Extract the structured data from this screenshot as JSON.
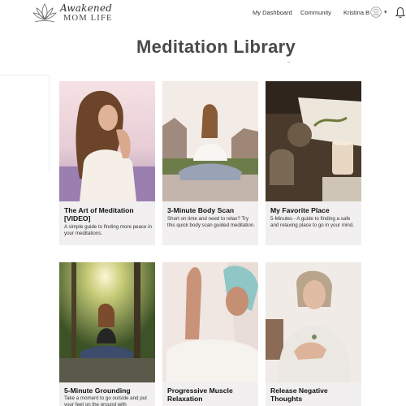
{
  "header": {
    "logo": {
      "line1": "Awakened",
      "line2": "MOM LIFE"
    },
    "nav": {
      "dashboard": "My Dashboard",
      "community": "Community",
      "user": "Kristina B"
    },
    "icons": {
      "avatar": "user-avatar-icon",
      "dropdown": "chevron-down-icon",
      "notifications": "bell-icon"
    }
  },
  "page": {
    "title": "Meditation Library"
  },
  "cards": [
    {
      "title": "The Art of Meditation [VIDEO]",
      "desc": "A simple guide to finding more peace in your meditations."
    },
    {
      "title": "3-Minute Body Scan",
      "desc": "Short on time and need to relax? Try this quick body scan guided meditation."
    },
    {
      "title": "My Favorite Place",
      "desc": "5-Minutes - A guide to finding a safe and relaxing place to go in your mind."
    },
    {
      "title": "5-Minute Grounding",
      "desc": "Take a moment to go outside and put your feet on the ground with"
    },
    {
      "title": "Progressive Muscle Relaxation",
      "desc": ""
    },
    {
      "title": "Release Negative Thoughts",
      "desc": ""
    }
  ],
  "colors": {
    "card_bg": "#f1eff0",
    "title_text": "#4a4a4a"
  }
}
